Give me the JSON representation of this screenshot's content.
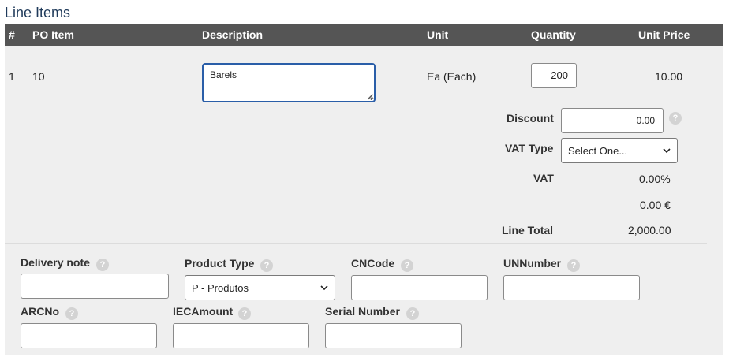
{
  "section_title": "Line Items",
  "columns": {
    "hash": "#",
    "po_item": "PO Item",
    "description": "Description",
    "unit": "Unit",
    "quantity": "Quantity",
    "unit_price": "Unit Price"
  },
  "row": {
    "index": "1",
    "po_item": "10",
    "description": "Barels",
    "unit": "Ea (Each)",
    "quantity": "200",
    "unit_price": "10.00"
  },
  "pricing": {
    "discount_label": "Discount",
    "discount_value": "0.00",
    "vat_type_label": "VAT Type",
    "vat_type_selected": "Select One...",
    "vat_label": "VAT",
    "vat_percent": "0.00%",
    "vat_amount": "0.00 €",
    "line_total_label": "Line Total",
    "line_total_value": "2,000.00"
  },
  "extra_fields": {
    "delivery_note_label": "Delivery note",
    "delivery_note_value": "",
    "product_type_label": "Product Type",
    "product_type_selected": "P - Produtos",
    "cncode_label": "CNCode",
    "cncode_value": "",
    "unnumber_label": "UNNumber",
    "unnumber_value": "",
    "arcno_label": "ARCNo",
    "arcno_value": "",
    "iecamount_label": "IECAmount",
    "iecamount_value": "",
    "serial_number_label": "Serial Number",
    "serial_number_value": ""
  },
  "help_glyph": "?",
  "icons": {
    "help": "help-circle-icon",
    "dropdown": "chevron-down-icon"
  },
  "colors": {
    "header_bg": "#555555",
    "panel_bg": "#efefef",
    "focus_border": "#2a5ea8",
    "title": "#1f3a5a"
  }
}
